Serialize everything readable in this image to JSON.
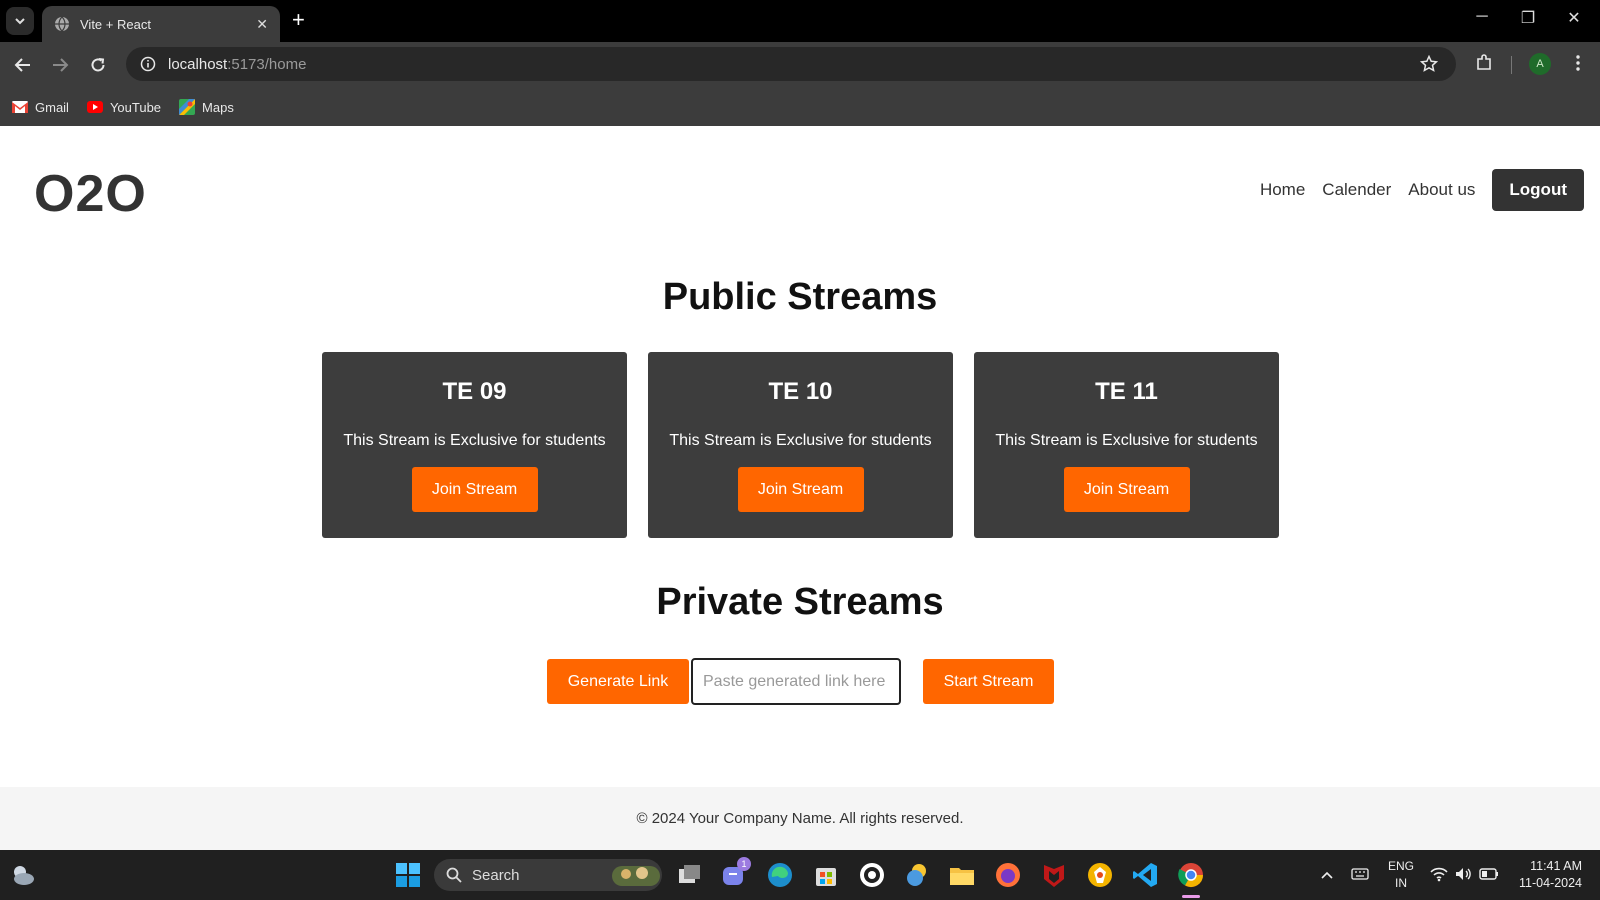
{
  "browser": {
    "tab_title": "Vite + React",
    "url_host": "localhost",
    "url_path": ":5173/home",
    "profile_initial": "A",
    "bookmarks": [
      {
        "label": "Gmail",
        "icon": "gmail-icon"
      },
      {
        "label": "YouTube",
        "icon": "youtube-icon"
      },
      {
        "label": "Maps",
        "icon": "maps-icon"
      }
    ]
  },
  "header": {
    "logo": "O2O",
    "nav": [
      "Home",
      "Calender",
      "About us"
    ],
    "logout_label": "Logout"
  },
  "public": {
    "title": "Public Streams",
    "cards": [
      {
        "title": "TE 09",
        "desc": "This Stream is Exclusive for students",
        "button": "Join Stream"
      },
      {
        "title": "TE 10",
        "desc": "This Stream is Exclusive for students",
        "button": "Join Stream"
      },
      {
        "title": "TE 11",
        "desc": "This Stream is Exclusive for students",
        "button": "Join Stream"
      }
    ]
  },
  "private": {
    "title": "Private Streams",
    "generate_label": "Generate Link",
    "link_placeholder": "Paste generated link here",
    "start_label": "Start Stream"
  },
  "footer": {
    "text": "© 2024 Your Company Name. All rights reserved."
  },
  "taskbar": {
    "search_label": "Search",
    "teams_badge": "1",
    "lang_line1": "ENG",
    "lang_line2": "IN",
    "time": "11:41 AM",
    "date": "11-04-2024"
  },
  "colors": {
    "accent": "#ff6600",
    "card_bg": "#3d3d3d",
    "logout_bg": "#333333"
  }
}
